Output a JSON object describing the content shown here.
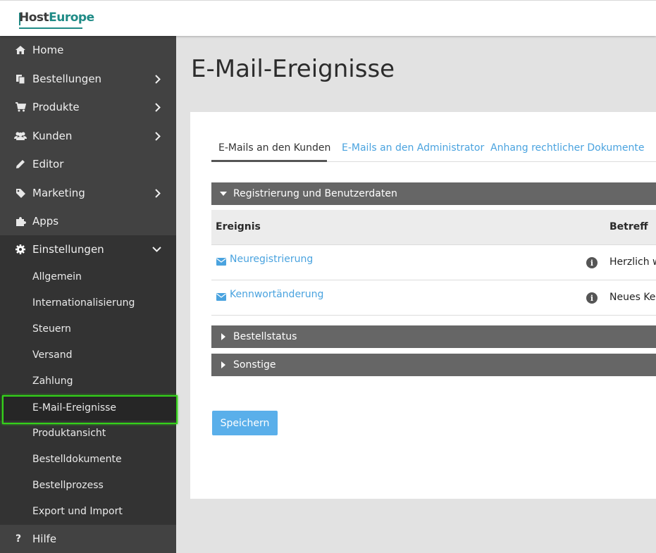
{
  "header": {
    "logo_part1": "Host",
    "logo_part2": "Europe"
  },
  "sidebar": {
    "items": [
      {
        "label": "Home",
        "icon": "home-icon",
        "has_chevron": false
      },
      {
        "label": "Bestellungen",
        "icon": "orders-icon",
        "has_chevron": true
      },
      {
        "label": "Produkte",
        "icon": "cart-icon",
        "has_chevron": true
      },
      {
        "label": "Kunden",
        "icon": "users-icon",
        "has_chevron": true
      },
      {
        "label": "Editor",
        "icon": "pencil-icon",
        "has_chevron": false
      },
      {
        "label": "Marketing",
        "icon": "tag-icon",
        "has_chevron": true
      },
      {
        "label": "Apps",
        "icon": "puzzle-icon",
        "has_chevron": false
      }
    ],
    "settings": {
      "label": "Einstellungen",
      "icon": "gear-icon",
      "expanded": true,
      "subitems": [
        "Allgemein",
        "Internationalisierung",
        "Steuern",
        "Versand",
        "Zahlung",
        "E-Mail-Ereignisse",
        "Produktansicht",
        "Bestelldokumente",
        "Bestellprozess",
        "Export und Import"
      ],
      "active_subitem": "E-Mail-Ereignisse"
    },
    "help": {
      "label": "Hilfe",
      "icon": "question-icon"
    }
  },
  "main": {
    "title": "E-Mail-Ereignisse",
    "tabs": [
      {
        "label": "E-Mails an den Kunden",
        "active": true
      },
      {
        "label": "E-Mails an den Administrator",
        "active": false
      },
      {
        "label": "Anhang rechtlicher Dokumente",
        "active": false
      }
    ],
    "sections": [
      {
        "label": "Registrierung und Benutzerdaten",
        "expanded": true,
        "columns": {
          "event": "Ereignis",
          "subject": "Betreff"
        },
        "rows": [
          {
            "event": "Neuregistrierung",
            "subject": "Herzlich w"
          },
          {
            "event": "Kennwortänderung",
            "subject": "Neues Ker"
          }
        ]
      },
      {
        "label": "Bestellstatus",
        "expanded": false
      },
      {
        "label": "Sonstige",
        "expanded": false
      }
    ],
    "save_label": "Speichern"
  },
  "colors": {
    "sidebar_bg": "#424242",
    "sidebar_settings_bg": "#333333",
    "link": "#4aa3df",
    "section_bar": "#666666",
    "primary_button": "#5aafea",
    "highlight": "#35d11b",
    "brand": "#1f8b86"
  }
}
